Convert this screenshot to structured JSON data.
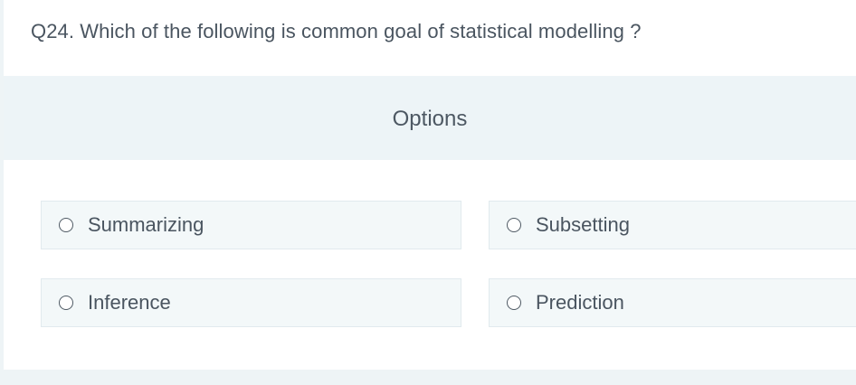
{
  "question": {
    "text": "Q24. Which of the following is common goal of statistical modelling ?"
  },
  "options_header": {
    "label": "Options"
  },
  "options": [
    {
      "label": "Summarizing",
      "selected": false
    },
    {
      "label": "Subsetting",
      "selected": false
    },
    {
      "label": "Inference",
      "selected": false
    },
    {
      "label": "Prediction",
      "selected": false
    }
  ]
}
